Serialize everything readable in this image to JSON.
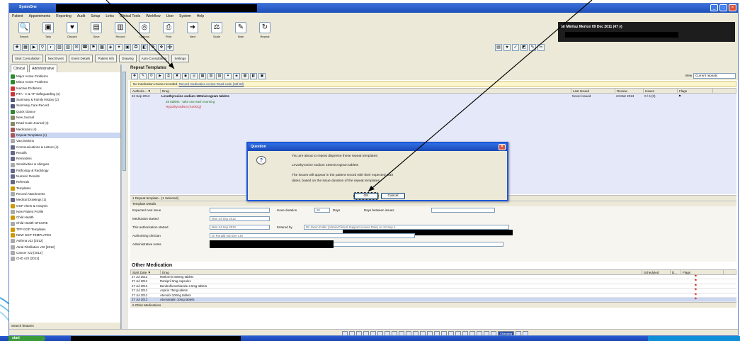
{
  "window": {
    "app_title": "SystmOne"
  },
  "menu": [
    "Patient",
    "Appointments",
    "Reporting",
    "Audit",
    "Setup",
    "Links",
    "Clinical Tools",
    "Workflow",
    "User",
    "System",
    "Help"
  ],
  "big_toolbar": [
    {
      "label": "Search",
      "icon": "magnifier-icon",
      "glyph": "🔍"
    },
    {
      "label": "Task",
      "icon": "task-icon",
      "glyph": "▣"
    },
    {
      "label": "Discard",
      "icon": "heart-icon",
      "glyph": "♥"
    },
    {
      "label": "Save",
      "icon": "save-icon",
      "glyph": "▤"
    },
    {
      "label": "Record",
      "icon": "record-icon",
      "glyph": "▥"
    },
    {
      "label": "Options",
      "icon": "options-icon",
      "glyph": "◎"
    },
    {
      "label": "Print",
      "icon": "print-icon",
      "glyph": "⎙"
    },
    {
      "label": "Next",
      "icon": "next-icon",
      "glyph": "➜"
    },
    {
      "label": "Scale",
      "icon": "scale-icon",
      "glyph": "⚖"
    },
    {
      "label": "Note",
      "icon": "note-icon",
      "glyph": "✎"
    },
    {
      "label": "Repeat",
      "icon": "repeat-icon",
      "glyph": "↻"
    }
  ],
  "patient_bar": {
    "text": "Mr Minhaz Merton 09 Dec 2011 (47 y)"
  },
  "consult_bar": [
    "Start Consultation",
    "Next Event",
    "Event Details",
    "Patient Info",
    "Drawing",
    "Auto-Consultation",
    "Settings"
  ],
  "sidebar": {
    "tabs": [
      "Clinical",
      "Administrative"
    ],
    "items": [
      {
        "label": "Major Active Problems",
        "color": "#2a8a2a"
      },
      {
        "label": "Minor Active Problems",
        "color": "#2a8a2a"
      },
      {
        "label": "Inactive Problems",
        "color": "#c33"
      },
      {
        "label": "RTA - C & YP Safeguarding (1)",
        "color": "#c33"
      },
      {
        "label": "Summary & Family History (2)",
        "color": "#557"
      },
      {
        "label": "Summary Care Record",
        "color": "#557"
      },
      {
        "label": "Quick Glance",
        "color": "#2a8a2a"
      },
      {
        "label": "New Journal",
        "color": "#886"
      },
      {
        "label": "Read Code Journal (4)",
        "color": "#886"
      },
      {
        "label": "Medication (4)",
        "color": "#a55"
      },
      {
        "label": "Repeat Templates (1)",
        "color": "#a55",
        "selected": true
      },
      {
        "label": "Vaccinations",
        "color": "#aaa"
      },
      {
        "label": "Communications & Letters (4)",
        "color": "#668"
      },
      {
        "label": "Recalls",
        "color": "#668"
      },
      {
        "label": "Reminders",
        "color": "#668"
      },
      {
        "label": "Sensitivities & Allergies",
        "color": "#aaa"
      },
      {
        "label": "Pathology & Radiology",
        "color": "#668"
      },
      {
        "label": "Numeric Results",
        "color": "#668"
      },
      {
        "label": "Referrals",
        "color": "#668"
      },
      {
        "label": "Templates",
        "color": "#c90"
      },
      {
        "label": "Record Attachments",
        "color": "#aaa"
      },
      {
        "label": "Medical Drawings (1)",
        "color": "#668"
      },
      {
        "label": "GGP Alerts & Analysis",
        "color": "#c90"
      },
      {
        "label": "New Patient Profile",
        "color": "#aaa"
      },
      {
        "label": "Child Health",
        "color": "#c90"
      },
      {
        "label": "Child Health NFCCRE",
        "color": "#aaa"
      },
      {
        "label": "TPP GGP Templates",
        "color": "#c90"
      },
      {
        "label": "NEW GGP TEMPLATES",
        "color": "#c90"
      },
      {
        "label": "Asthma v22 [2012]",
        "color": "#aaa"
      },
      {
        "label": "Atrial Fibrillation v22 [2012]",
        "color": "#aaa"
      },
      {
        "label": "Cancer v22 [2012]",
        "color": "#aaa"
      },
      {
        "label": "CHD v22 [2012]",
        "color": "#aaa"
      }
    ],
    "footer": "Search features"
  },
  "repeat_templates": {
    "title": "Repeat Templates",
    "view_label": "View",
    "view_value": "Current repeats",
    "review_notice": "No medication review recorded.",
    "review_link": "Record medication review Read code (0af.0d)",
    "columns": [
      "Authoris... ▼",
      "Drug",
      "Last Issued",
      "Review",
      "Issues",
      "Flags"
    ],
    "row": {
      "date": "24 Sep 2012",
      "drug": "Levothyroxine sodium 100microgram tablets",
      "dose": "28 tablets - take one each morning",
      "indication": "Hypothyroidism (X40GQ)",
      "last_issued": "Never issued",
      "review": "24 Mar 2013",
      "issues": "0 / 6 (0)"
    },
    "footer": "1 Repeat template - (1 Selected)"
  },
  "template_details": {
    "title": "Template Details",
    "fields": {
      "expected_next_issue_label": "Expected next issue",
      "issue_duration_label": "Issue duration",
      "issue_duration_value": "28",
      "issue_duration_unit": "Days",
      "days_between_label": "Days between issues",
      "medication_started_label": "Medication started",
      "medication_started_value": "Mon 24 Sep 2012",
      "authorisation_label": "This authorisation started",
      "authorisation_value": "Mon 24 Sep 2012",
      "entered_by_label": "Entered by",
      "entered_by_value": "Mr Jason Fuller (Admin/Clinical Support Access Role) on 24 Sep 2",
      "authorising_clinician_label": "Authorising clinician",
      "authorising_clinician_value": "Dr Ronald Van Der Lim",
      "admin_notes_label": "Administrative notes"
    }
  },
  "other_medication": {
    "title": "Other Medication",
    "columns": [
      "Start Date ▼",
      "Drug",
      "Scheduled",
      "D...",
      "Flags"
    ],
    "rows": [
      {
        "date": "27 Jul 2012",
        "drug": "Metformin 500mg tablets"
      },
      {
        "date": "27 Jul 2012",
        "drug": "Ramipril 5mg capsules"
      },
      {
        "date": "27 Jul 2012",
        "drug": "Bendroflumethiazide 2.5mg tablets"
      },
      {
        "date": "27 Jul 2012",
        "drug": "Aspirin 75mg tablets"
      },
      {
        "date": "27 Jul 2012",
        "drug": "Atenolol 100mg tablets"
      },
      {
        "date": "27 Jul 2012",
        "drug": "Atorvastatin 10mg tablets",
        "selected": true
      }
    ],
    "footer": "6 Other Medications"
  },
  "status_bar": {
    "changing_label": "Changing"
  },
  "dialog": {
    "title": "Question",
    "line1": "You are about to repeat dispense these repeat templates:",
    "line2": "Levothyroxine sodium 100microgram tablets",
    "line3": "The issues will appear in the patient record with their expected start",
    "line4": "dates, based on the issue duration of the repeat templates.",
    "ok": "OK",
    "cancel": "Cancel"
  },
  "taskbar": {
    "start": "start"
  },
  "colors": {
    "titlebar": "#1f4fb8",
    "highlight_row": "#e5e8f8",
    "dialog_border": "#1d57d8"
  }
}
